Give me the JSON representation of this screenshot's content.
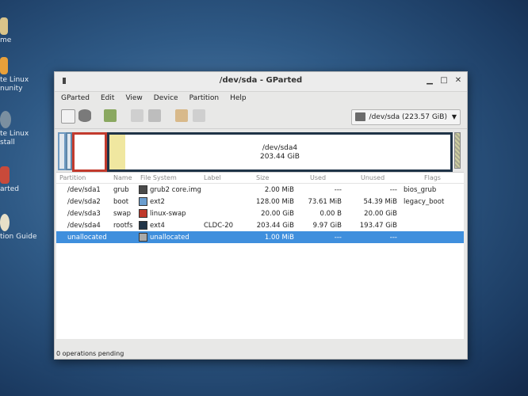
{
  "desktop": {
    "icons": [
      {
        "label": "me",
        "icon": "home-folder-icon"
      },
      {
        "label": "te Linux\nnunity",
        "icon": "community-icon"
      },
      {
        "label": "te Linux\nstall",
        "icon": "install-icon"
      },
      {
        "label": "arted",
        "icon": "gparted-icon"
      },
      {
        "label": "tion Guide",
        "icon": "guide-icon"
      }
    ]
  },
  "window": {
    "title": "/dev/sda - GParted"
  },
  "menu": {
    "items": [
      "GParted",
      "Edit",
      "View",
      "Device",
      "Partition",
      "Help"
    ]
  },
  "device_selector": {
    "value": "/dev/sda  (223.57 GiB)"
  },
  "graph": {
    "sda4_name": "/dev/sda4",
    "sda4_size": "203.44 GiB"
  },
  "table": {
    "headers": [
      "Partition",
      "Name",
      "File System",
      "Label",
      "Size",
      "Used",
      "Unused",
      "Flags"
    ],
    "rows": [
      {
        "partition": "/dev/sda1",
        "name": "grub",
        "fs": "grub2 core.img",
        "fs_color": "#4a4a4a",
        "label": "",
        "size": "2.00 MiB",
        "used": "---",
        "unused": "---",
        "flags": "bios_grub"
      },
      {
        "partition": "/dev/sda2",
        "name": "boot",
        "fs": "ext2",
        "fs_color": "#6b9ecf",
        "label": "",
        "size": "128.00 MiB",
        "used": "73.61 MiB",
        "unused": "54.39 MiB",
        "flags": "legacy_boot"
      },
      {
        "partition": "/dev/sda3",
        "name": "swap",
        "fs": "linux-swap",
        "fs_color": "#c0392b",
        "label": "",
        "size": "20.00 GiB",
        "used": "0.00 B",
        "unused": "20.00 GiB",
        "flags": ""
      },
      {
        "partition": "/dev/sda4",
        "name": "rootfs",
        "fs": "ext4",
        "fs_color": "#1f3347",
        "label": "CLDC-20",
        "size": "203.44 GiB",
        "used": "9.97 GiB",
        "unused": "193.47 GiB",
        "flags": ""
      },
      {
        "partition": "unallocated",
        "name": "",
        "fs": "unallocated",
        "fs_color": "#a9a9a9",
        "label": "",
        "size": "1.00 MiB",
        "used": "---",
        "unused": "---",
        "flags": ""
      }
    ]
  },
  "status": {
    "text": "0 operations pending"
  }
}
